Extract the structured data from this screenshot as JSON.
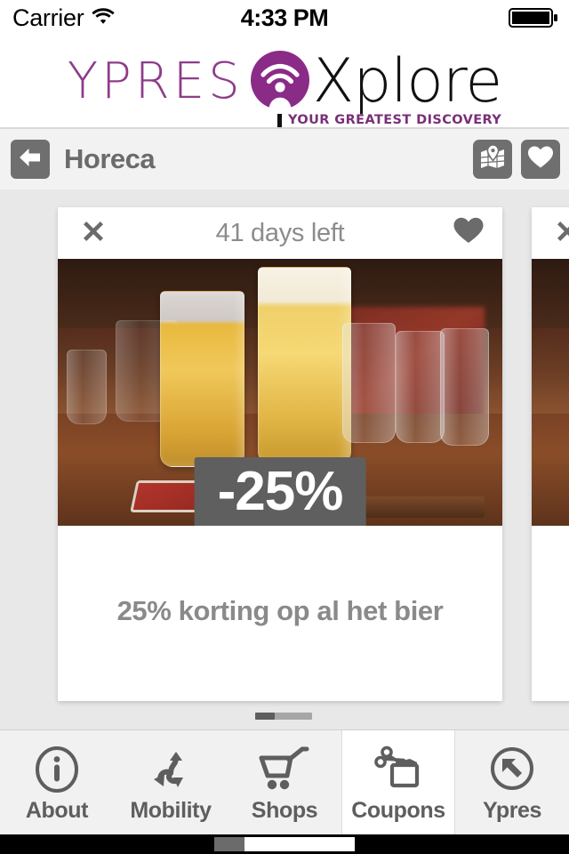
{
  "status_bar": {
    "carrier": "Carrier",
    "wifi_icon": "wifi-icon",
    "time": "4:33 PM",
    "battery_icon": "battery-full-icon"
  },
  "brand_header": {
    "name_primary": "YPRES",
    "name_secondary": "Xplore",
    "tagline": "YOUR GREATEST DISCOVERY",
    "logo_icon": "ypres-xplore-logo-icon",
    "primary_color": "#8e3c8a",
    "secondary_color": "#111111",
    "tagline_color": "#7a2f78"
  },
  "navbar": {
    "back_icon": "arrow-left-icon",
    "title": "Horeca",
    "actions": [
      {
        "id": "map",
        "icon": "map-pin-icon"
      },
      {
        "id": "favorites",
        "icon": "heart-icon"
      }
    ],
    "button_color": "#6f6f6f",
    "background": "#f2f2f2"
  },
  "coupon_card": {
    "close_icon": "close-x-icon",
    "expiry_label": "41 days left",
    "favorite_icon": "heart-filled-icon",
    "discount_badge": "-25%",
    "description": "25% korting op al het bier",
    "photo_alt": "beer-glasses-photo",
    "badge_background": "#5f5f5f",
    "badge_text_color": "#ffffff"
  },
  "coupon_card_next": {
    "close_icon": "close-x-icon"
  },
  "scroll_indicator": {
    "name": "carousel-scroll-indicator"
  },
  "tabbar": {
    "selected": "Coupons",
    "items": [
      {
        "label": "About",
        "icon": "info-circle-icon",
        "selected": false
      },
      {
        "label": "Mobility",
        "icon": "mobility-arrows-icon",
        "selected": false
      },
      {
        "label": "Shops",
        "icon": "shopping-cart-icon",
        "selected": false
      },
      {
        "label": "Coupons",
        "icon": "coupon-scissors-icon",
        "selected": true
      },
      {
        "label": "Ypres",
        "icon": "arrow-circle-icon",
        "selected": false
      }
    ],
    "icon_color": "#5e5e5e",
    "background": "#f1f1f1",
    "selected_background": "#ffffff"
  },
  "home_bar": {
    "name": "home-indicator"
  }
}
